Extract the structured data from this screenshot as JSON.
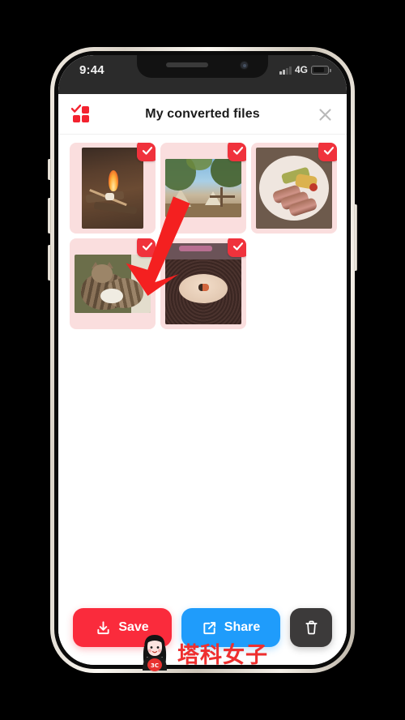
{
  "status_bar": {
    "time": "9:44",
    "network": "4G",
    "signal_icon": "cellular-signal-icon",
    "battery_icon": "battery-icon"
  },
  "app": {
    "brand_logo_icon": "four-squares-check-logo",
    "title": "My converted files",
    "close_icon": "close-x-icon"
  },
  "files": [
    {
      "name": "campfire-marshmallow-photo",
      "selected": true,
      "check_icon": "checkmark-icon",
      "orientation": "portrait"
    },
    {
      "name": "campsite-trees-photo",
      "selected": true,
      "check_icon": "checkmark-icon",
      "orientation": "landscape"
    },
    {
      "name": "steak-plate-photo",
      "selected": true,
      "check_icon": "checkmark-icon",
      "orientation": "square"
    },
    {
      "name": "sleeping-cats-photo",
      "selected": true,
      "check_icon": "checkmark-icon",
      "orientation": "landscape"
    },
    {
      "name": "soup-bowl-photo",
      "selected": true,
      "check_icon": "checkmark-icon",
      "orientation": "portrait"
    }
  ],
  "actions": {
    "save_label": "Save",
    "save_icon": "download-icon",
    "share_label": "Share",
    "share_icon": "share-external-link-icon",
    "trash_icon": "trash-can-icon"
  },
  "annotation": {
    "arrow_icon": "red-down-left-arrow",
    "arrow_color": "#f42020"
  },
  "watermark": {
    "text": "塔科女子",
    "avatar_icon": "girl-avatar-3c-logo",
    "badge_text": "3C"
  },
  "colors": {
    "save_red": "#fa2b3c",
    "share_blue": "#1f9cfb",
    "trash_dark": "#3c3a3a",
    "thumb_bg_pink": "#fadede",
    "brand_red": "#f3222f",
    "watermark_red": "#ef2f2f"
  }
}
